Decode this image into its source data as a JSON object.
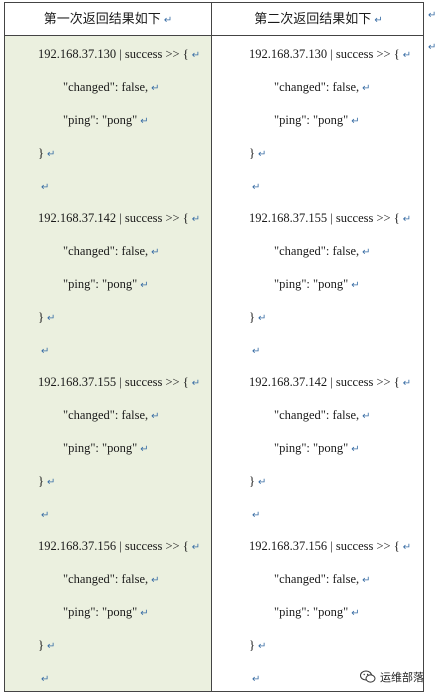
{
  "header": {
    "left_title": "第一次返回结果如下",
    "right_title": "第二次返回结果如下",
    "return_mark": "↵"
  },
  "left_column": [
    {
      "ip_line": "192.168.37.130 | success >> {",
      "changed_line": "\"changed\": false,",
      "ping_line": "\"ping\": \"pong\"",
      "close_line": "}"
    },
    {
      "ip_line": "192.168.37.142 | success >> {",
      "changed_line": "\"changed\": false,",
      "ping_line": "\"ping\": \"pong\"",
      "close_line": "}"
    },
    {
      "ip_line": "192.168.37.155 | success >> {",
      "changed_line": "\"changed\": false,",
      "ping_line": "\"ping\": \"pong\"",
      "close_line": "}"
    },
    {
      "ip_line": "192.168.37.156 | success >> {",
      "changed_line": "\"changed\": false,",
      "ping_line": "\"ping\": \"pong\"",
      "close_line": "}"
    }
  ],
  "right_column": [
    {
      "ip_line": "192.168.37.130 | success >> {",
      "changed_line": "\"changed\": false,",
      "ping_line": "\"ping\": \"pong\"",
      "close_line": "}"
    },
    {
      "ip_line": "192.168.37.155 | success >> {",
      "changed_line": "\"changed\": false,",
      "ping_line": "\"ping\": \"pong\"",
      "close_line": "}"
    },
    {
      "ip_line": "192.168.37.142 | success >> {",
      "changed_line": "\"changed\": false,",
      "ping_line": "\"ping\": \"pong\"",
      "close_line": "}"
    },
    {
      "ip_line": "192.168.37.156 | success >> {",
      "changed_line": "\"changed\": false,",
      "ping_line": "\"ping\": \"pong\"",
      "close_line": "}"
    }
  ],
  "watermark": {
    "text": "运维部落",
    "logo_icon": "wechat-logo-icon"
  },
  "colors": {
    "left_background": "#ebf0df",
    "return_mark": "#3a6ea5",
    "border": "#444444"
  }
}
